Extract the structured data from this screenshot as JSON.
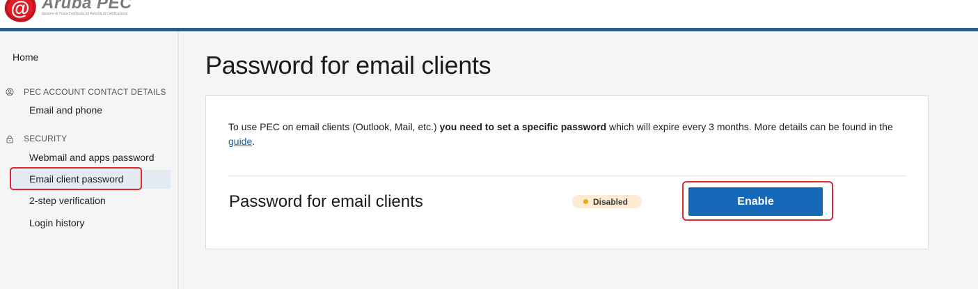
{
  "header": {
    "brand_name": "Aruba PEC",
    "brand_tagline": "Gestore di Posta Certificata ed Autorità di Certificazione",
    "accent_color": "#2f5d86"
  },
  "sidebar": {
    "home": "Home",
    "sections": [
      {
        "icon": "user-circle-icon",
        "title": "PEC ACCOUNT CONTACT DETAILS",
        "items": [
          "Email and phone"
        ]
      },
      {
        "icon": "lock-icon",
        "title": "SECURITY",
        "items": [
          "Webmail and apps password",
          "Email client password",
          "2-step verification",
          "Login history"
        ]
      }
    ],
    "active_item": "Email client password"
  },
  "main": {
    "title": "Password for email clients",
    "intro": {
      "text_before": "To use PEC on email clients (Outlook, Mail, etc.) ",
      "bold": "you need to set a specific password",
      "text_after": " which will expire every 3 months. More details can be found in the ",
      "link": "guide",
      "end": "."
    },
    "setting": {
      "label": "Password for email clients",
      "status": "Disabled",
      "status_color": "#f2a51a",
      "action": "Enable",
      "action_color": "#1669b8"
    }
  }
}
